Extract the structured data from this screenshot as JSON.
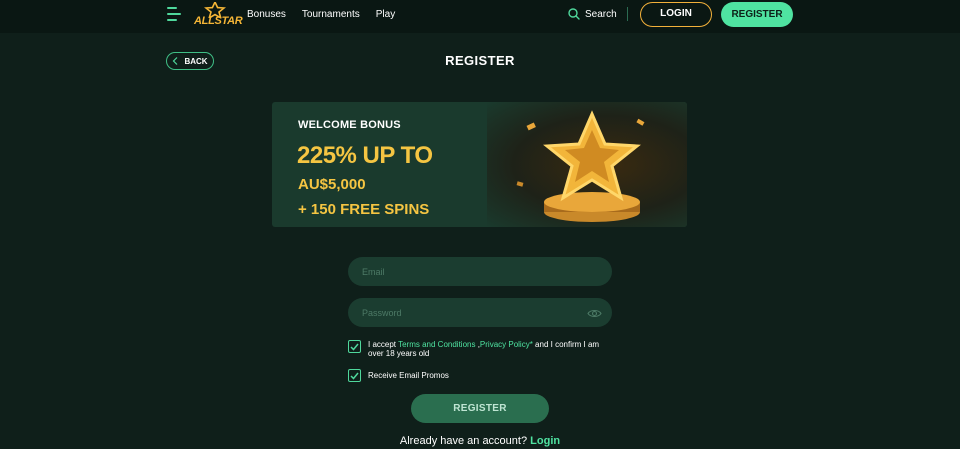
{
  "header": {
    "logo_text": "ALLSTAR",
    "nav": [
      "Bonuses",
      "Tournaments",
      "Play"
    ],
    "search_label": "Search",
    "login_label": "LOGIN",
    "register_label": "REGISTER",
    "accent_color": "#4fe3a1",
    "gold_color": "#f5c542"
  },
  "page": {
    "back_label": "BACK",
    "title": "REGISTER"
  },
  "banner": {
    "kicker": "WELCOME BONUS",
    "amount": "225% UP TO",
    "currency": "AU$5,000",
    "spins": "+ 150 FREE SPINS"
  },
  "form": {
    "email_placeholder": "Email",
    "password_placeholder": "Password",
    "terms_prefix": "I accept ",
    "terms_link": "Terms and Conditions",
    "terms_sep": " ,",
    "privacy_link": "Privacy Policy*",
    "terms_suffix": " and I confirm I am over 18 years old",
    "terms_checked": true,
    "promos_label": "Receive Email Promos",
    "promos_checked": true,
    "submit_label": "REGISTER"
  },
  "footer": {
    "prompt": "Already have an account?",
    "login_link": "Login"
  }
}
